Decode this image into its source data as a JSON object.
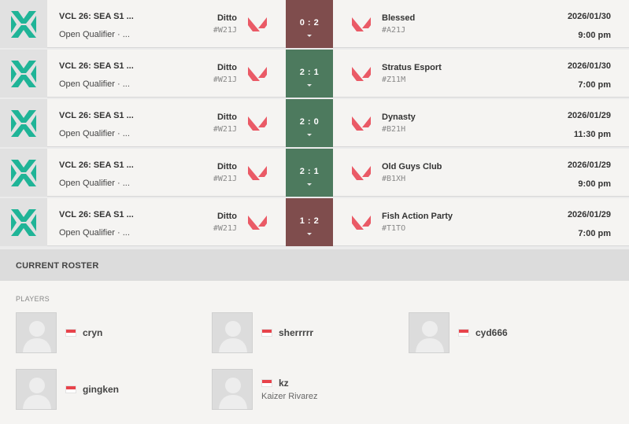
{
  "colors": {
    "loss": "#7f4d4d",
    "win": "#4d7a5e",
    "valorant_red": "#ea5a66",
    "vct_teal": "#1fb497"
  },
  "matches": [
    {
      "event": "VCL 26: SEA S1 ...",
      "stage": "Open Qualifier · ...",
      "team1": "Ditto",
      "team1_tag": "#W21J",
      "score": "0 : 2",
      "result": "loss",
      "team2": "Blessed",
      "team2_tag": "#A21J",
      "date": "2026/01/30",
      "time": "9:00 pm"
    },
    {
      "event": "VCL 26: SEA S1 ...",
      "stage": "Open Qualifier · ...",
      "team1": "Ditto",
      "team1_tag": "#W21J",
      "score": "2 : 1",
      "result": "win",
      "team2": "Stratus Esport",
      "team2_tag": "#Z11M",
      "date": "2026/01/30",
      "time": "7:00 pm"
    },
    {
      "event": "VCL 26: SEA S1 ...",
      "stage": "Open Qualifier · ...",
      "team1": "Ditto",
      "team1_tag": "#W21J",
      "score": "2 : 0",
      "result": "win",
      "team2": "Dynasty",
      "team2_tag": "#B21H",
      "date": "2026/01/29",
      "time": "11:30 pm"
    },
    {
      "event": "VCL 26: SEA S1 ...",
      "stage": "Open Qualifier · ...",
      "team1": "Ditto",
      "team1_tag": "#W21J",
      "score": "2 : 1",
      "result": "win",
      "team2": "Old Guys Club",
      "team2_tag": "#B1XH",
      "date": "2026/01/29",
      "time": "9:00 pm"
    },
    {
      "event": "VCL 26: SEA S1 ...",
      "stage": "Open Qualifier · ...",
      "team1": "Ditto",
      "team1_tag": "#W21J",
      "score": "1 : 2",
      "result": "loss",
      "team2": "Fish Action Party",
      "team2_tag": "#T1TO",
      "date": "2026/01/29",
      "time": "7:00 pm"
    }
  ],
  "roster": {
    "title": "CURRENT ROSTER",
    "players_label": "PLAYERS",
    "players": [
      {
        "handle": "cryn",
        "real_name": "",
        "flag": "singapore-flag"
      },
      {
        "handle": "sherrrrr",
        "real_name": "",
        "flag": "singapore-flag"
      },
      {
        "handle": "cyd666",
        "real_name": "",
        "flag": "singapore-flag"
      },
      {
        "handle": "gingken",
        "real_name": "",
        "flag": "singapore-flag"
      },
      {
        "handle": "kz",
        "real_name": "Kaizer Rivarez",
        "flag": "singapore-flag"
      }
    ]
  }
}
